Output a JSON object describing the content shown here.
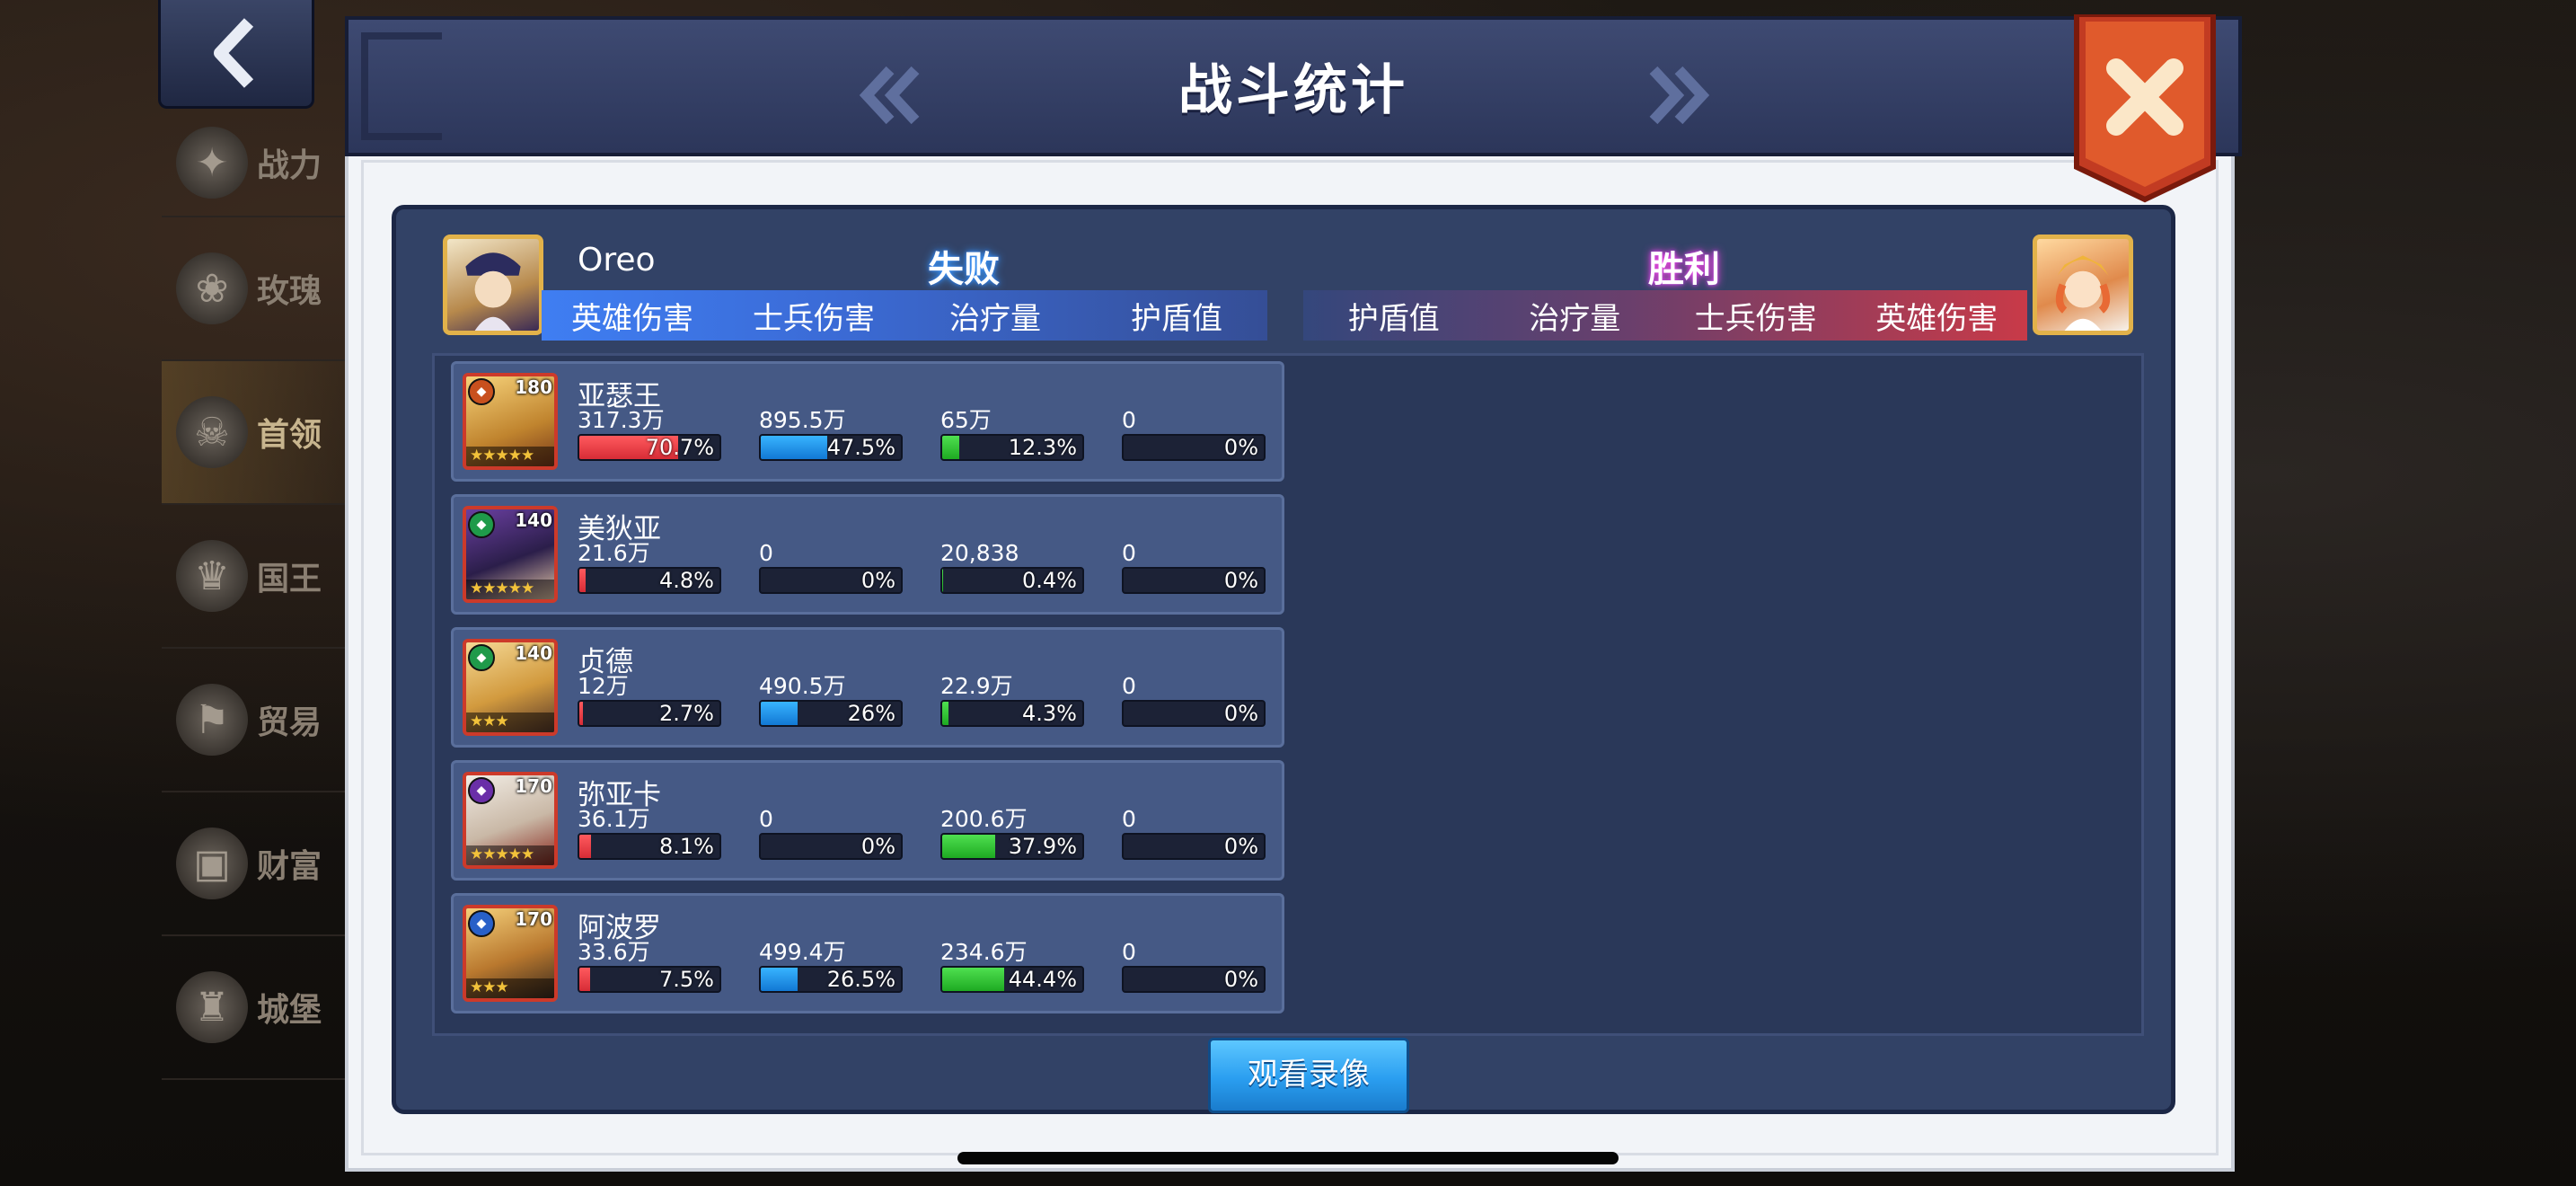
{
  "side_menu": [
    {
      "label": "战力",
      "icon": "wings-icon"
    },
    {
      "label": "玫瑰",
      "icon": "rose-icon"
    },
    {
      "label": "首领",
      "icon": "skull-icon"
    },
    {
      "label": "国王",
      "icon": "crown-icon"
    },
    {
      "label": "贸易",
      "icon": "trade-icon"
    },
    {
      "label": "财富",
      "icon": "chest-icon"
    },
    {
      "label": "城堡",
      "icon": "castle-icon"
    }
  ],
  "dialog": {
    "title": "战斗统计",
    "watch_replay": "观看录像"
  },
  "left_team": {
    "player_name": "Oreo",
    "result": "失败",
    "columns": [
      "英雄伤害",
      "士兵伤害",
      "治疗量",
      "护盾值"
    ]
  },
  "right_team": {
    "player_name": "",
    "result": "胜利",
    "columns": [
      "护盾值",
      "治疗量",
      "士兵伤害",
      "英雄伤害"
    ]
  },
  "heroes": [
    {
      "name": "亚瑟王",
      "level": "180",
      "stars": 5,
      "faction_color": "#c8501e",
      "hero_damage": "317.3万",
      "hero_damage_pct": "70.7%",
      "hero_damage_frac": 0.707,
      "troop_damage": "895.5万",
      "troop_damage_pct": "47.5%",
      "troop_damage_frac": 0.475,
      "healing": "65万",
      "healing_pct": "12.3%",
      "healing_frac": 0.123,
      "shield": "0",
      "shield_pct": "0%",
      "shield_frac": 0
    },
    {
      "name": "美狄亚",
      "level": "140",
      "stars": 5,
      "faction_color": "#1f9a4a",
      "hero_damage": "21.6万",
      "hero_damage_pct": "4.8%",
      "hero_damage_frac": 0.048,
      "troop_damage": "0",
      "troop_damage_pct": "0%",
      "troop_damage_frac": 0,
      "healing": "20,838",
      "healing_pct": "0.4%",
      "healing_frac": 0.004,
      "shield": "0",
      "shield_pct": "0%",
      "shield_frac": 0
    },
    {
      "name": "贞德",
      "level": "140",
      "stars": 3,
      "faction_color": "#1f9a4a",
      "hero_damage": "12万",
      "hero_damage_pct": "2.7%",
      "hero_damage_frac": 0.027,
      "troop_damage": "490.5万",
      "troop_damage_pct": "26%",
      "troop_damage_frac": 0.26,
      "healing": "22.9万",
      "healing_pct": "4.3%",
      "healing_frac": 0.043,
      "shield": "0",
      "shield_pct": "0%",
      "shield_frac": 0
    },
    {
      "name": "弥亚卡",
      "level": "170",
      "stars": 5,
      "faction_color": "#6a2fa8",
      "hero_damage": "36.1万",
      "hero_damage_pct": "8.1%",
      "hero_damage_frac": 0.081,
      "troop_damage": "0",
      "troop_damage_pct": "0%",
      "troop_damage_frac": 0,
      "healing": "200.6万",
      "healing_pct": "37.9%",
      "healing_frac": 0.379,
      "shield": "0",
      "shield_pct": "0%",
      "shield_frac": 0
    },
    {
      "name": "阿波罗",
      "level": "170",
      "stars": 3,
      "faction_color": "#2860c8",
      "hero_damage": "33.6万",
      "hero_damage_pct": "7.5%",
      "hero_damage_frac": 0.075,
      "troop_damage": "499.4万",
      "troop_damage_pct": "26.5%",
      "troop_damage_frac": 0.265,
      "healing": "234.6万",
      "healing_pct": "44.4%",
      "healing_frac": 0.444,
      "shield": "0",
      "shield_pct": "0%",
      "shield_frac": 0
    }
  ]
}
